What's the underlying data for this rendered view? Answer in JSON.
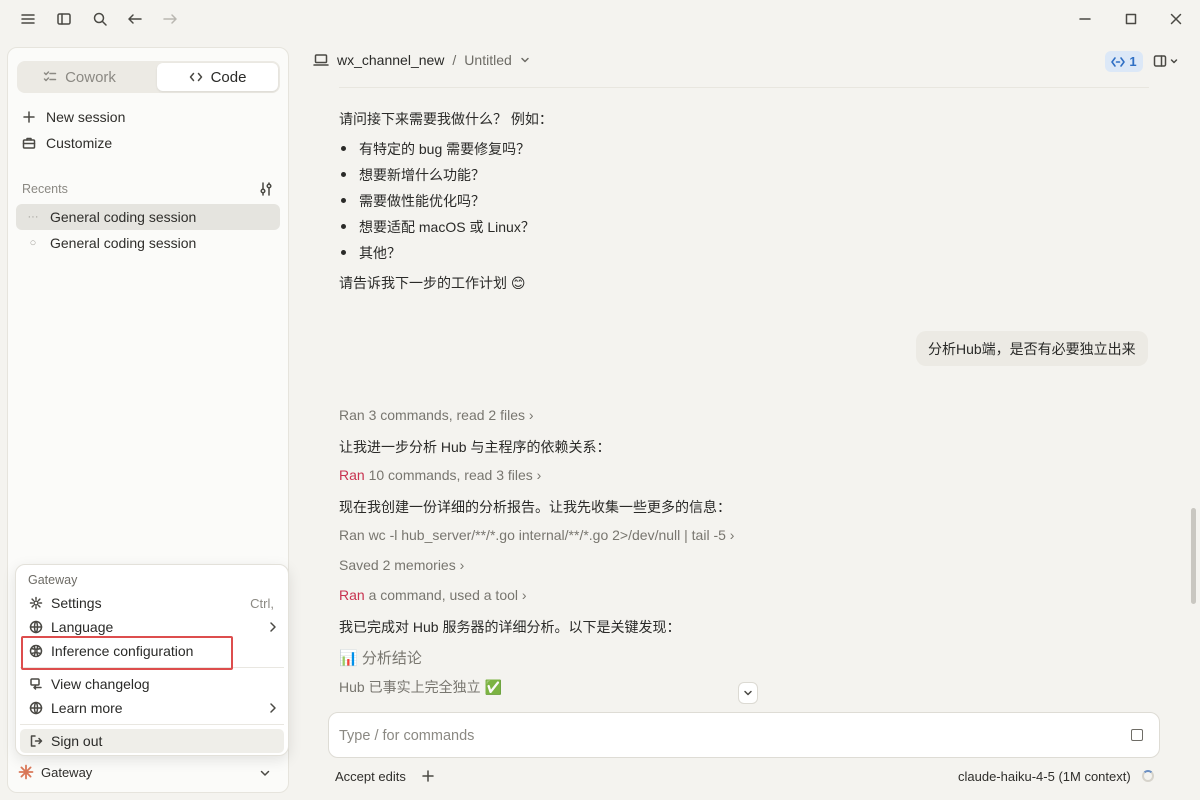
{
  "sidebar": {
    "mode_tabs": [
      {
        "label": "Cowork",
        "active": false
      },
      {
        "label": "Code",
        "active": true
      }
    ],
    "new_session_label": "New session",
    "customize_label": "Customize",
    "recents_label": "Recents",
    "sessions": [
      {
        "label": "General coding session",
        "active": true
      },
      {
        "label": "General coding session",
        "active": false
      }
    ],
    "footer_label": "Gateway"
  },
  "menu": {
    "title": "Gateway",
    "items": [
      {
        "label": "Settings",
        "shortcut": "Ctrl,"
      },
      {
        "label": "Language"
      },
      {
        "label": "Inference configuration"
      },
      {
        "label": "View changelog"
      },
      {
        "label": "Learn more"
      },
      {
        "label": "Sign out"
      }
    ]
  },
  "header": {
    "project": "wx_channel_new",
    "separator": "/",
    "document": "Untitled",
    "badge_count": "1"
  },
  "conversation": {
    "intro": "请问接下来需要我做什么？ 例如：",
    "bullets": [
      "有特定的 bug 需要修复吗？",
      "想要新增什么功能？",
      "需要做性能优化吗？",
      "想要适配 macOS 或 Linux？",
      "其他？"
    ],
    "closing": "请告诉我下一步的工作计划 😊",
    "user_message": "分析Hub端，是否有必要独立出来",
    "steps": [
      {
        "prefix": "",
        "text": "Ran 3 commands, read 2 files ›",
        "kind": "tool"
      },
      {
        "prefix": "",
        "text": "让我进一步分析 Hub 与主程序的依赖关系：",
        "kind": "text"
      },
      {
        "prefix": "Ran",
        "text": " 10 commands, read 3 files ›",
        "kind": "tool"
      },
      {
        "prefix": "",
        "text": "现在我创建一份详细的分析报告。让我先收集一些更多的信息：",
        "kind": "text"
      },
      {
        "prefix": "",
        "text": "Ran wc -l hub_server/**/*.go internal/**/*.go 2>/dev/null | tail -5 ›",
        "kind": "tool"
      },
      {
        "prefix": "",
        "text": "Saved 2 memories ›",
        "kind": "tool"
      },
      {
        "prefix": "Ran",
        "text": " a command, used a tool ›",
        "kind": "tool"
      },
      {
        "prefix": "",
        "text": "我已完成对 Hub 服务器的详细分析。以下是关键发现：",
        "kind": "text"
      },
      {
        "prefix": "",
        "text": "📊 分析结论",
        "kind": "tool"
      },
      {
        "prefix": "",
        "text": "Hub 已事实上完全独立 ✅",
        "kind": "tool"
      }
    ]
  },
  "composer": {
    "placeholder": "Type / for commands",
    "accept_edits_label": "Accept edits",
    "model_label": "claude-haiku-4-5 (1M context)"
  },
  "colors": {
    "accent_red": "#c8324f",
    "highlight_border": "#dd4d4d",
    "badge_blue": "#2f6fc4",
    "claude_orange": "#d97757"
  }
}
